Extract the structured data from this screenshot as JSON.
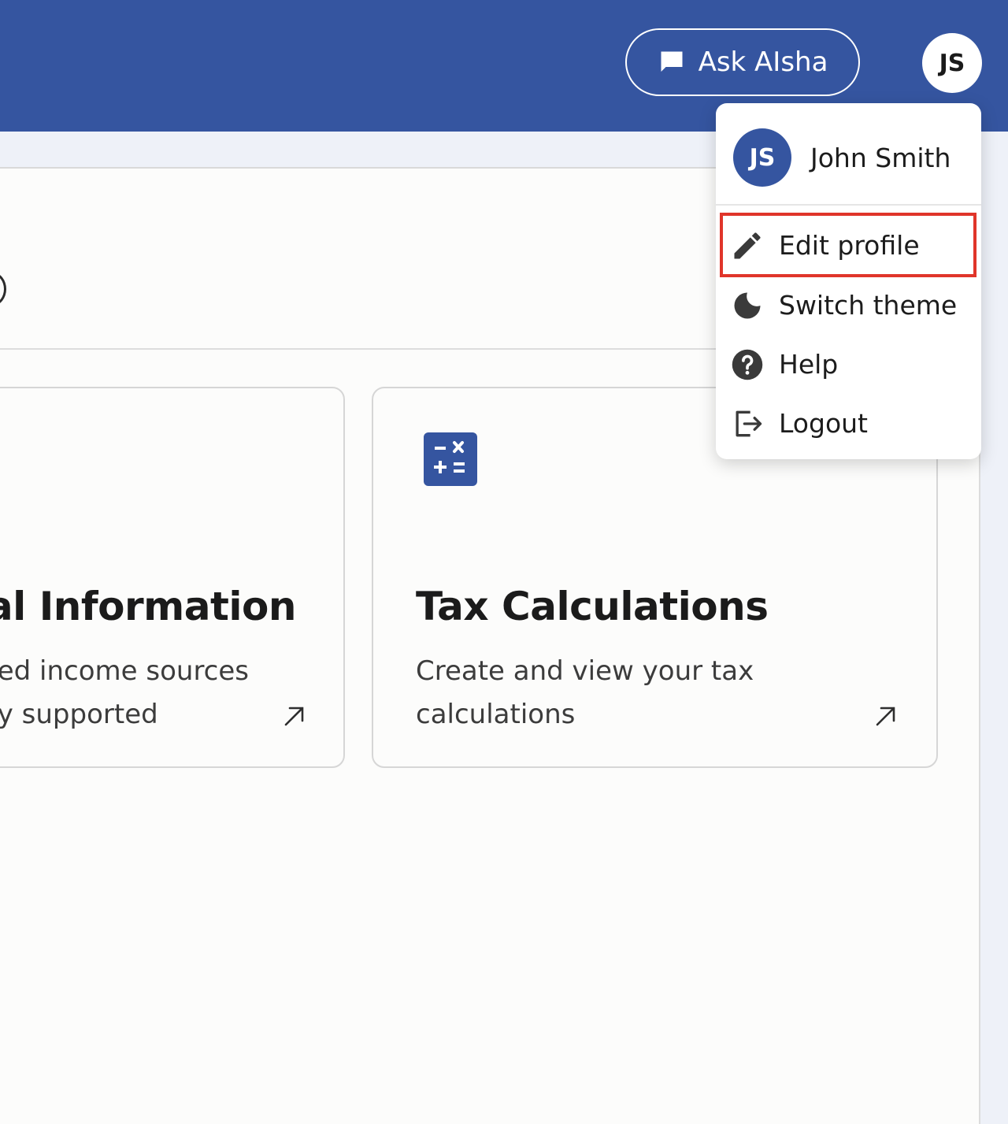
{
  "header": {
    "ask_button_label": "Ask AIsha",
    "ask_button_icon": "chat-bubble-icon",
    "avatar_initials": "JS",
    "bar_color": "#3555a0"
  },
  "cards": [
    {
      "title": "al Information",
      "description_line1": "ed income sources",
      "description_line2": "y supported",
      "arrow_icon": "arrow-up-right-icon"
    },
    {
      "icon": "calculator-icon",
      "title": "Tax Calculations",
      "description": "Create and view your tax calculations",
      "arrow_icon": "arrow-up-right-icon"
    }
  ],
  "user_menu": {
    "avatar_initials": "JS",
    "user_name": "John Smith",
    "items": [
      {
        "label": "Edit profile",
        "icon": "pencil-icon",
        "highlighted": true,
        "highlight_color": "#e0352a"
      },
      {
        "label": "Switch theme",
        "icon": "moon-icon"
      },
      {
        "label": "Help",
        "icon": "help-circle-icon"
      },
      {
        "label": "Logout",
        "icon": "logout-icon"
      }
    ]
  }
}
